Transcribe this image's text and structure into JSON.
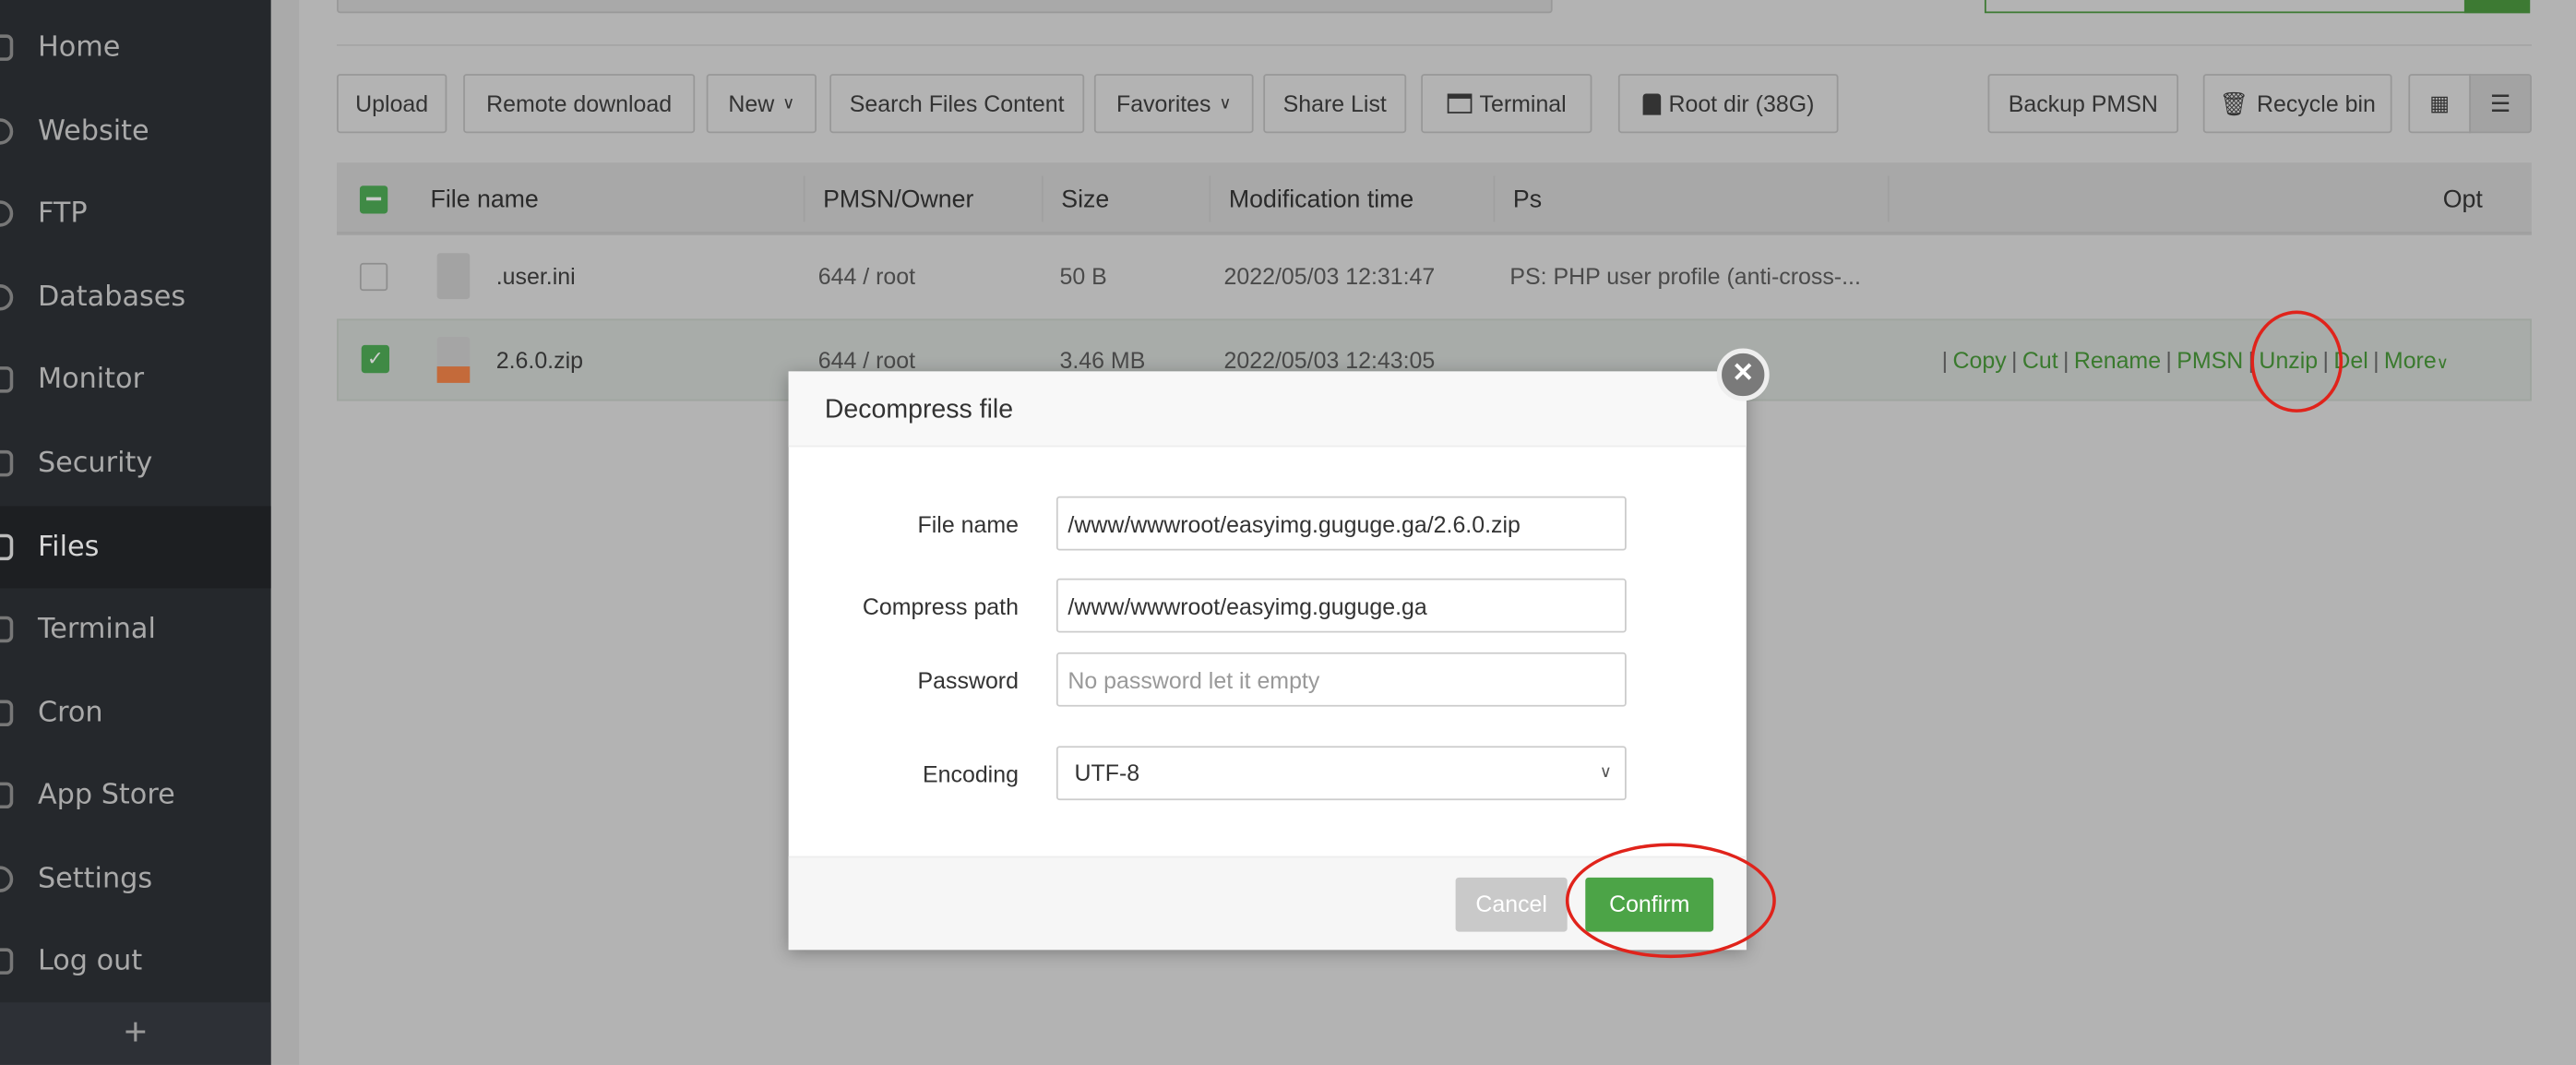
{
  "sidebar": {
    "items": [
      {
        "label": "Home",
        "icon": "home-icon"
      },
      {
        "label": "Website",
        "icon": "globe-icon"
      },
      {
        "label": "FTP",
        "icon": "ftp-icon"
      },
      {
        "label": "Databases",
        "icon": "database-icon"
      },
      {
        "label": "Monitor",
        "icon": "monitor-icon"
      },
      {
        "label": "Security",
        "icon": "shield-icon"
      },
      {
        "label": "Files",
        "icon": "folder-icon",
        "active": true
      },
      {
        "label": "Terminal",
        "icon": "terminal-icon"
      },
      {
        "label": "Cron",
        "icon": "calendar-icon"
      },
      {
        "label": "App Store",
        "icon": "apps-icon"
      },
      {
        "label": "Settings",
        "icon": "gear-icon"
      },
      {
        "label": "Log out",
        "icon": "logout-icon"
      }
    ],
    "add_label": "+"
  },
  "toolbar": {
    "upload": "Upload",
    "remote_download": "Remote download",
    "new": "New",
    "search_content": "Search Files Content",
    "favorites": "Favorites",
    "share_list": "Share List",
    "terminal": "Terminal",
    "root_dir": "Root dir (38G)",
    "backup_pmsn": "Backup PMSN",
    "recycle_bin": "Recycle bin"
  },
  "table": {
    "headers": {
      "name": "File name",
      "owner": "PMSN/Owner",
      "size": "Size",
      "mtime": "Modification time",
      "ps": "Ps",
      "opt": "Opt"
    },
    "rows": [
      {
        "name": ".user.ini",
        "owner": "644 / root",
        "size": "50 B",
        "mtime": "2022/05/03 12:31:47",
        "ps": "PS: PHP user profile (anti-cross-...",
        "checked": false
      },
      {
        "name": "2.6.0.zip",
        "owner": "644 / root",
        "size": "3.46 MB",
        "mtime": "2022/05/03 12:43:05",
        "ps": "",
        "checked": true,
        "ops": [
          "Copy",
          "Cut",
          "Rename",
          "PMSN",
          "Unzip",
          "Del",
          "More"
        ]
      }
    ]
  },
  "modal": {
    "title": "Decompress file",
    "file_name_label": "File name",
    "file_name": "/www/wwwroot/easyimg.guguge.ga/2.6.0.zip",
    "path_label": "Compress path",
    "path": "/www/wwwroot/easyimg.guguge.ga",
    "password_label": "Password",
    "password_placeholder": "No password let it empty",
    "encoding_label": "Encoding",
    "encoding": "UTF-8",
    "cancel": "Cancel",
    "confirm": "Confirm"
  },
  "colors": {
    "accent": "#4ca447",
    "link": "#3a7a2e",
    "annotation": "#e0231b"
  }
}
